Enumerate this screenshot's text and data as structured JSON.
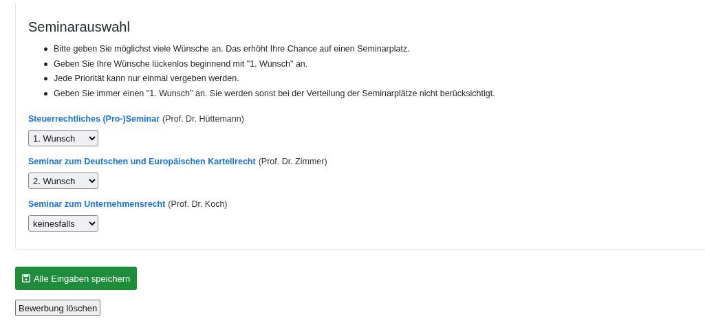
{
  "section": {
    "title": "Seminarauswahl",
    "instructions": [
      "Bitte geben Sie möglichst viele Wünsche an. Das erhöht Ihre Chance auf einen Seminarplatz.",
      "Geben Sie Ihre Wünsche lückenlos beginnend mit \"1. Wunsch\" an.",
      "Jede Priorität kann nur einmal vergeben werden.",
      "Geben Sie immer einen \"1. Wunsch\" an. Sie werden sonst bei der Verteilung der Seminarplätze nicht berücksichtigt."
    ],
    "seminars": [
      {
        "name": "Steuerrechtliches (Pro-)Seminar",
        "lecturer": "(Prof. Dr. Hüttemann)",
        "priority": "1. Wunsch"
      },
      {
        "name": "Seminar zum Deutschen und Europäischen Kartellrecht",
        "lecturer": "(Prof. Dr. Zimmer)",
        "priority": "2. Wunsch"
      },
      {
        "name": "Seminar zum Unternehmensrecht",
        "lecturer": "(Prof. Dr. Koch)",
        "priority": "keinesfalls"
      }
    ]
  },
  "buttons": [
    {
      "kind": "save",
      "label": "Alle Eingaben speichern"
    },
    {
      "kind": "delete",
      "label": "Bewerbung löschen"
    }
  ]
}
